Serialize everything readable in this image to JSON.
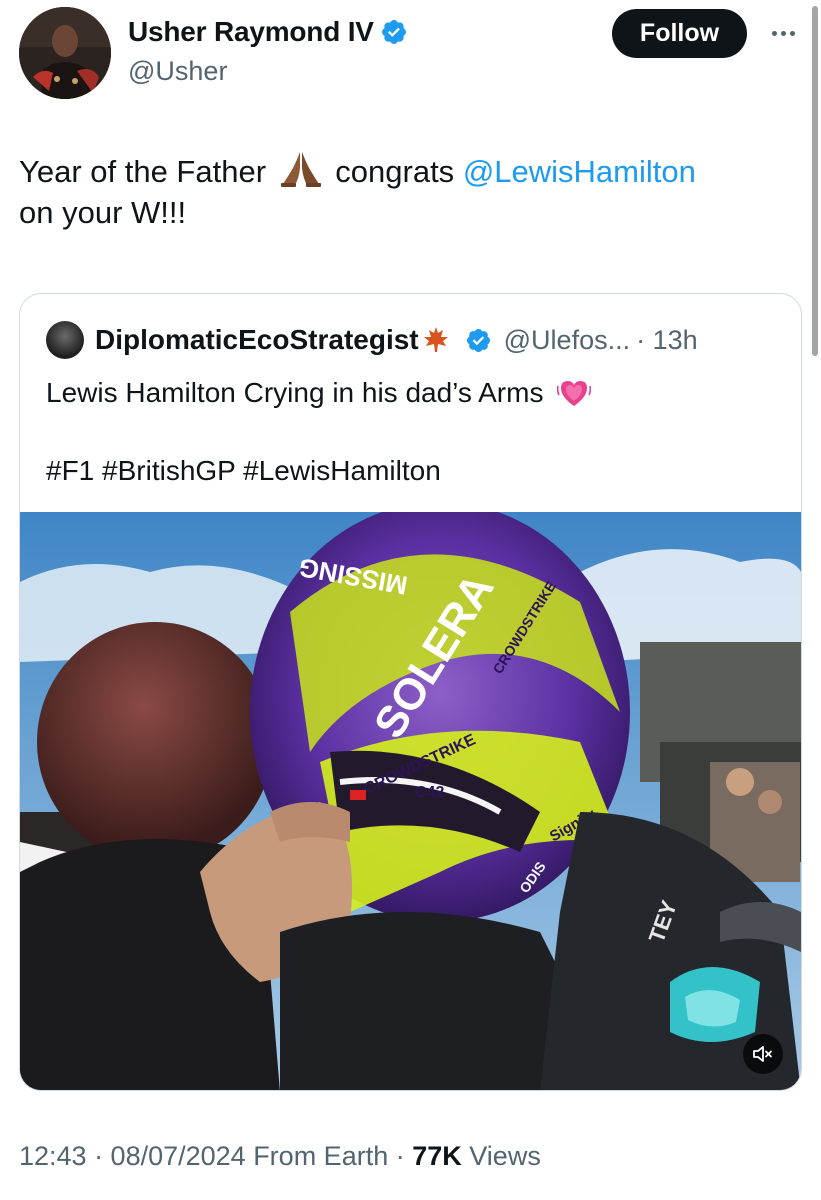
{
  "author": {
    "display_name": "Usher Raymond IV",
    "handle": "@Usher",
    "follow_label": "Follow"
  },
  "tweet": {
    "text_part1": "Year of the Father",
    "text_part2": "congrats",
    "mention": "@LewisHamilton",
    "text_part3": "on your W!!!"
  },
  "quote": {
    "display_name": "DiplomaticEcoStrategist",
    "handle": "@Ulefos...",
    "time": "· 13h",
    "text": "Lewis Hamilton Crying in his dad’s Arms",
    "hashtags": "#F1 #BritishGP #LewisHamilton",
    "helmet_words": {
      "missing": "MISSING",
      "solera": "SOLERA",
      "crowdstrike": "CROWDSTRIKE",
      "strike_lower": "CROWDSTRIKE",
      "strike_top": "CROWDSTRIKE",
      "c42": "C42",
      "signify": "Signify",
      "odis": "ODIS",
      "suit": "TEY"
    }
  },
  "meta": {
    "time": "12:43 · 08/07/2024 From Earth ·",
    "views_count": "77K",
    "views_label": "Views"
  },
  "colors": {
    "accent": "#1d9bf0",
    "text": "#0f1419",
    "secondary": "#536471",
    "border": "#cfd9de"
  },
  "icons": {
    "verified": "verified-badge-icon",
    "more": "more-options-icon",
    "mute": "volume-muted-icon",
    "hands": "folded-hands-emoji",
    "heart": "growing-heart-emoji",
    "leaf": "maple-leaf-emoji"
  }
}
